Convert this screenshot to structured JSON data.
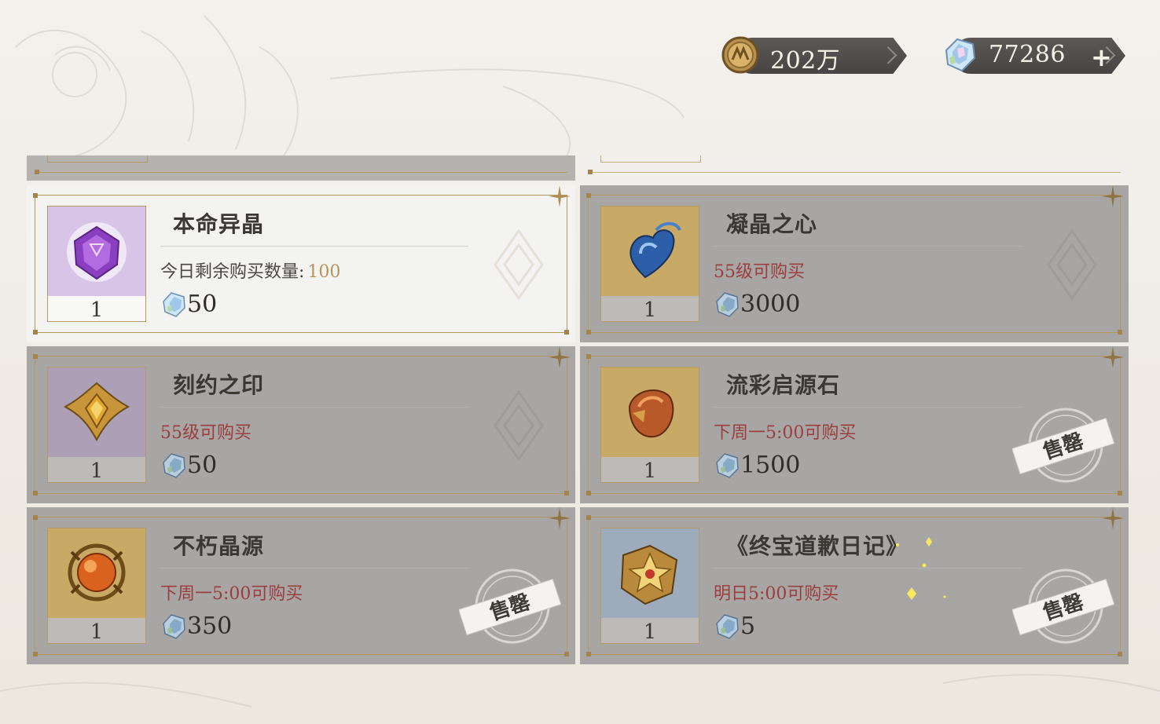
{
  "currency": {
    "coins": "202万",
    "gems": "77286",
    "gems_add": "+"
  },
  "shop": {
    "items": [
      {
        "name": "本命异晶",
        "qty": "1",
        "note": "今日剩余购买数量:",
        "note_num": "100",
        "price": "50",
        "state": "selected",
        "bg": "#d7c4e6"
      },
      {
        "name": "凝晶之心",
        "qty": "1",
        "note": "55级可购买",
        "price": "3000",
        "state": "locked",
        "bg": "#d9b874"
      },
      {
        "name": "刻约之印",
        "qty": "1",
        "note": "55级可购买",
        "price": "50",
        "state": "locked",
        "bg": "#c4b4cf"
      },
      {
        "name": "流彩启源石",
        "qty": "1",
        "note": "下周一5:00可购买",
        "price": "1500",
        "state": "sold-out",
        "badge": "售罄",
        "bg": "#d9b874"
      },
      {
        "name": "不朽晶源",
        "qty": "1",
        "note": "下周一5:00可购买",
        "price": "350",
        "state": "sold-out",
        "badge": "售罄",
        "bg": "#d9b874"
      },
      {
        "name": "《终宝道歉日记》",
        "qty": "1",
        "note": "明日5:00可购买",
        "price": "5",
        "state": "sold-out",
        "badge": "售罄",
        "bg": "#b6c3d2"
      }
    ]
  },
  "colors": {
    "accent_gold": "#b8925a",
    "locked_red": "#9c3e3e",
    "card_dim": "#a7a6a4"
  }
}
